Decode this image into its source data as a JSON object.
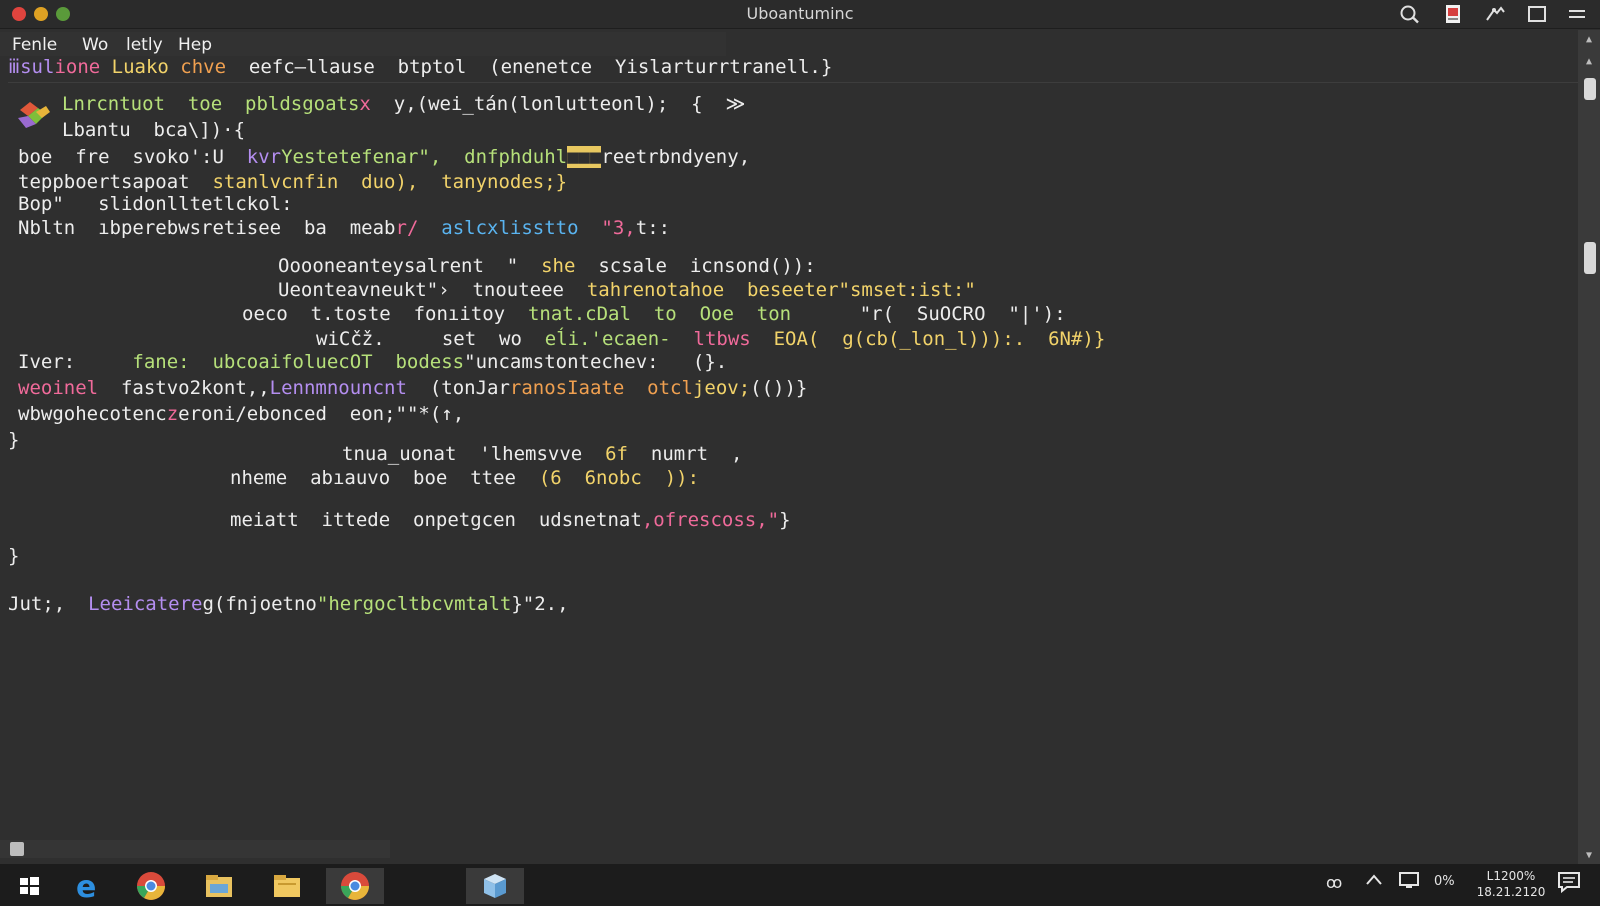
{
  "window": {
    "title": "Uboantuminc"
  },
  "colors": {
    "background": "#2f2f2f",
    "green": "#b6e07a",
    "yellow": "#f2d36a",
    "blue": "#5ab4f0",
    "pink": "#f06a9a",
    "purple": "#b48ef0",
    "close": "#e0443e",
    "minimize": "#dea123",
    "maximize": "#5a9a3a"
  },
  "titlebar_icons": [
    "search-icon",
    "document-icon",
    "tools-icon",
    "window-icon",
    "menu-icon"
  ],
  "menu": {
    "items": [
      "Fenle",
      "Wo",
      "letly",
      "Hep"
    ]
  },
  "path": {
    "part1": "ⅲsul",
    "part2": "ione",
    "part3": " Luako",
    "part4": " chve",
    "part5": "  eefc—llause  btptol  (enenetce  Yislarturrtranell.}"
  },
  "code": {
    "l1a": "Lnrcntuot  toe  pbldsgoats",
    "l1b": "x",
    "l1c": "  y,(wei_tán(lonlutteonl);  {  ≫",
    "l2": "Lbantu  bca\\])·{",
    "l3a": "boe  fre  svoko':U  ",
    "l3b": "kvr",
    "l3c": "Yestetefenar\",  dnfphduhl",
    "l3d": "■■■",
    "l3e": "reetrbndyeny,",
    "l4a": "teppboertsapoat  ",
    "l4b": "stanlvcnfin  duo),  tanynodes;}",
    "l5": "Bop\"   slidonlltetlckol:",
    "l6a": "Nbltn  ıbperebwsretisee  ba  meab",
    "l6b": "r/",
    "l6c": "  aslcxlisstto  ",
    "l6d": "\"3,",
    "l6e": "t::",
    "l7a": "Ooooneanteysalrent  \"  ",
    "l7b": "she",
    "l7c": "  scsale  icnsond()):",
    "l8a": "Ueonteavneukt\"›  tnouteee  ",
    "l8b": "tahrenotahoe  beseeter\"smset:ist:\"",
    "l9a": "oeco  t.toste  fonıitoy  ",
    "l9b": "tnat.cDal  to  Ooe  ton",
    "l9c": "      \"r(  SuOCRO  \"|'):",
    "l10a": "wiCčž.     set  wo  ",
    "l10b": "eĺi.'ecaen-  ",
    "l10c": "ltbws  ",
    "l10d": "EOA(  g(cb(_lon_l))):.  6N#)}",
    "l11a": "Iver:     ",
    "l11b": "fane:  ",
    "l11c": "ubcoaifoluecOT  bodess",
    "l11d": "\"uncamstontechev:   (}.",
    "l12a": "weoinel  ",
    "l12b": "fastvo2kont,,",
    "l12c": "Lennmnouncnt",
    "l12d": "  (tonJar",
    "l12e": "ranosIaate  otcl",
    "l12f": "jeov;",
    "l12g": "(())}",
    "l13a": "wbwgohecotenc",
    "l13b": "z",
    "l13c": "eroni/ebonced  eon;\"\"*(↑,",
    "l14": "}",
    "l15a": "tnua_uonat  'lhemsvve  ",
    "l15b": "6f",
    "l15c": "  numrt  ,",
    "l16a": "nheme  abıauvo  boe  ttee  ",
    "l16b": "(6  6nobc  )):",
    "l17a": "meiatt  ittede  onpetgcen  udsnetnat",
    "l17b": ",ofrescoss,\"",
    "l17c": "}",
    "l18": "}",
    "l19a": "Jut;,",
    "l19b": "  Leeicatere",
    "l19c": "g(fnjoetno",
    "l19d": "\"hergocltbcvmtalt",
    "l19e": "}\"2.,"
  },
  "taskbar": {
    "icons": [
      "windows-start-icon",
      "edge-icon",
      "chrome-icon",
      "file-explorer-icon",
      "folder-icon",
      "chrome-active-icon",
      "app-cube-icon"
    ],
    "tray": {
      "link_label": "ꝏ",
      "battery_label": "0%",
      "time": "L1200%",
      "date": "18.21.2120"
    }
  }
}
